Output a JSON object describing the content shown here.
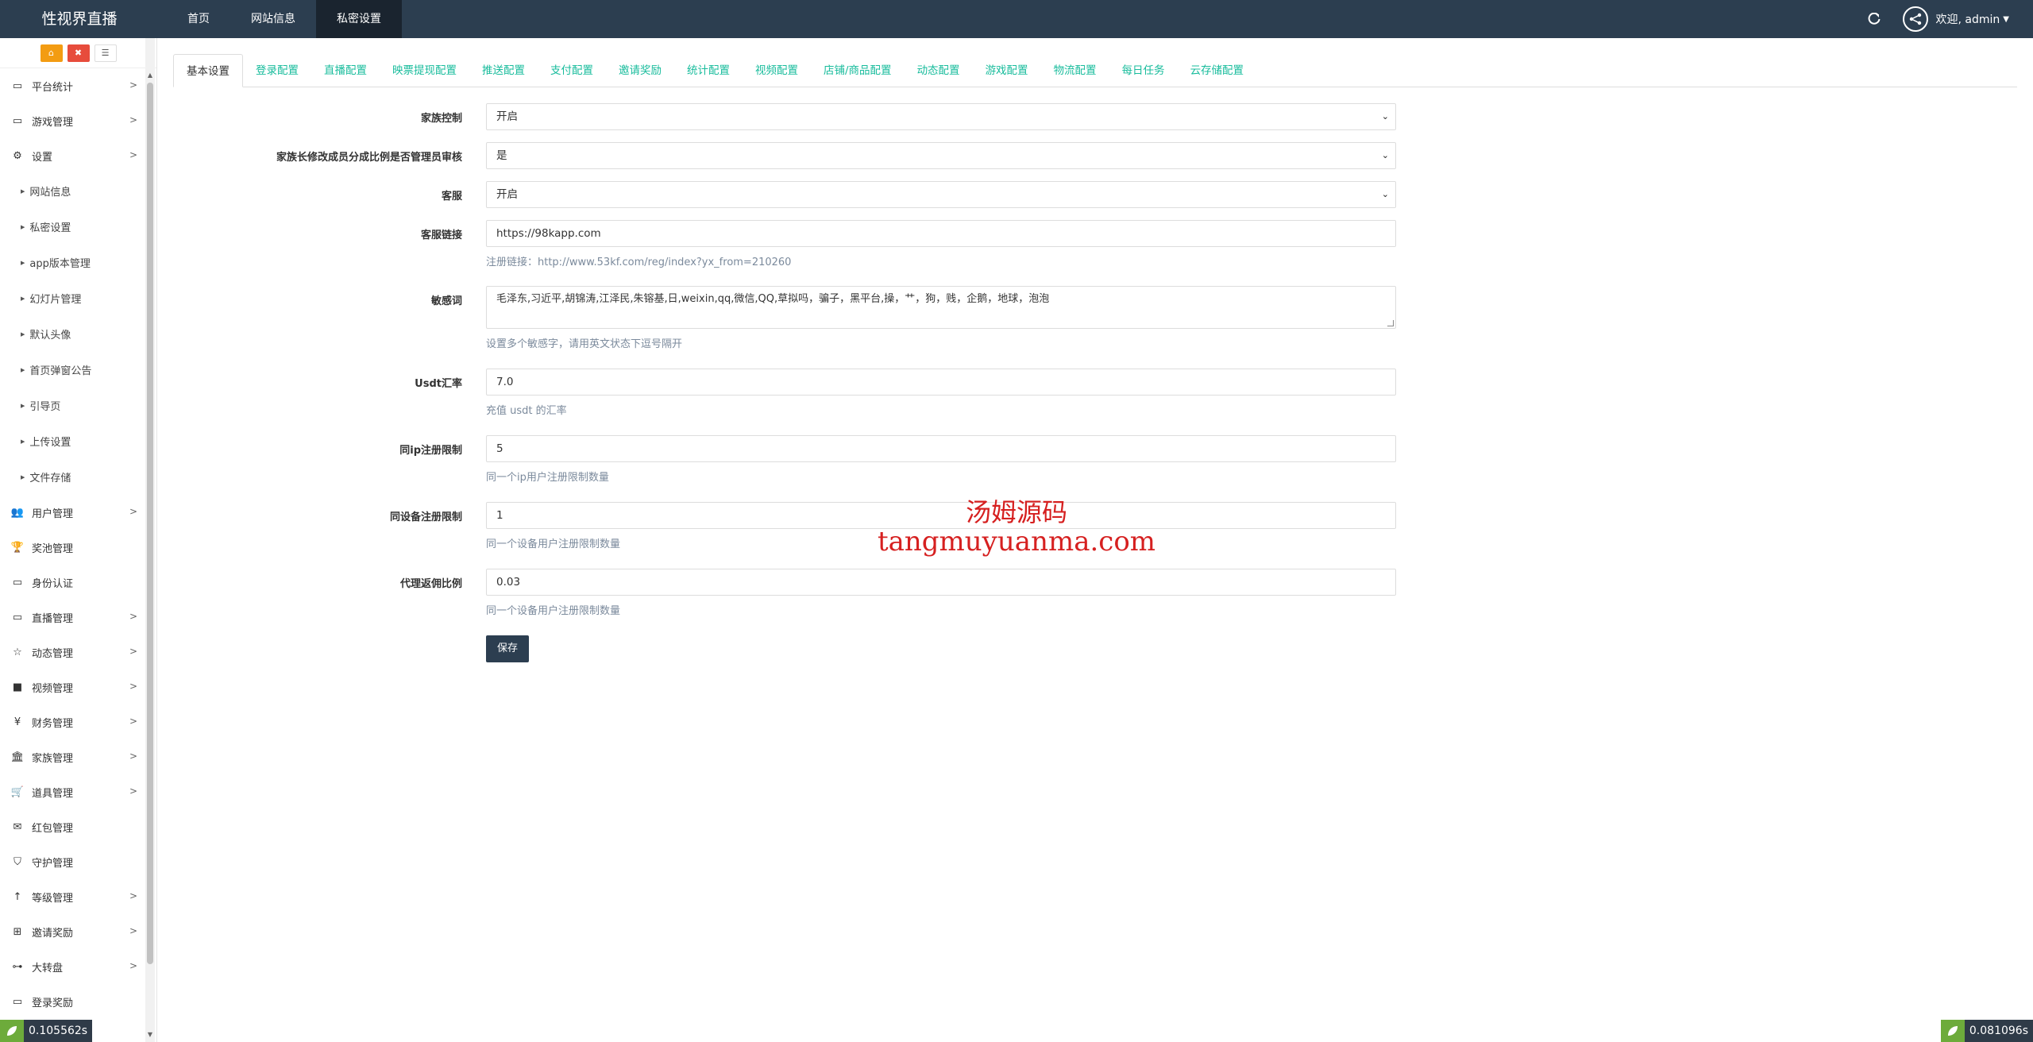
{
  "topbar": {
    "brand": "性视界直播",
    "nav": [
      "首页",
      "网站信息",
      "私密设置"
    ],
    "user": "欢迎, admin"
  },
  "sidebar": {
    "items": [
      {
        "label": "平台统计",
        "icon": "monitor-icon",
        "arrow": true
      },
      {
        "label": "游戏管理",
        "icon": "monitor-icon",
        "arrow": true
      },
      {
        "label": "设置",
        "icon": "cogs-icon",
        "arrow": true
      }
    ],
    "sub_items": [
      "网站信息",
      "私密设置",
      "app版本管理",
      "幻灯片管理",
      "默认头像",
      "首页弹窗公告",
      "引导页",
      "上传设置",
      "文件存储"
    ],
    "items_after": [
      {
        "label": "用户管理",
        "icon": "users-icon",
        "arrow": true
      },
      {
        "label": "奖池管理",
        "icon": "trophy-icon",
        "arrow": false
      },
      {
        "label": "身份认证",
        "icon": "monitor-icon",
        "arrow": false
      },
      {
        "label": "直播管理",
        "icon": "monitor-icon",
        "arrow": true
      },
      {
        "label": "动态管理",
        "icon": "star-icon",
        "arrow": true
      },
      {
        "label": "视频管理",
        "icon": "video-icon",
        "arrow": true
      },
      {
        "label": "财务管理",
        "icon": "yen-icon",
        "arrow": true
      },
      {
        "label": "家族管理",
        "icon": "bank-icon",
        "arrow": true
      },
      {
        "label": "道具管理",
        "icon": "cart-icon",
        "arrow": true
      },
      {
        "label": "红包管理",
        "icon": "envelope-icon",
        "arrow": false
      },
      {
        "label": "守护管理",
        "icon": "shield-icon",
        "arrow": false
      },
      {
        "label": "等级管理",
        "icon": "level-up-icon",
        "arrow": true
      },
      {
        "label": "邀请奖励",
        "icon": "sitemap-icon",
        "arrow": true
      },
      {
        "label": "大转盘",
        "icon": "gamepad-icon",
        "arrow": true
      },
      {
        "label": "登录奖励",
        "icon": "monitor-icon",
        "arrow": false
      }
    ]
  },
  "tabs": [
    "基本设置",
    "登录配置",
    "直播配置",
    "映票提现配置",
    "推送配置",
    "支付配置",
    "邀请奖励",
    "统计配置",
    "视频配置",
    "店铺/商品配置",
    "动态配置",
    "游戏配置",
    "物流配置",
    "每日任务",
    "云存储配置"
  ],
  "form": {
    "family_control": {
      "label": "家族控制",
      "value": "开启"
    },
    "family_review": {
      "label": "家族长修改成员分成比例是否管理员审核",
      "value": "是"
    },
    "service": {
      "label": "客服",
      "value": "开启"
    },
    "service_link": {
      "label": "客服链接",
      "value": "https://98kapp.com",
      "help": "注册链接：http://www.53kf.com/reg/index?yx_from=210260"
    },
    "sensitive": {
      "label": "敏感词",
      "value": "毛泽东,习近平,胡锦涛,江泽民,朱镕基,日,weixin,qq,微信,QQ,草拟吗，骗子，黑平台,操，艹，狗，贱，企鹅，地球，泡泡",
      "help": "设置多个敏感字，请用英文状态下逗号隔开"
    },
    "usdt": {
      "label": "Usdt汇率",
      "value": "7.0",
      "help": "充值 usdt 的汇率"
    },
    "ip_limit": {
      "label": "同ip注册限制",
      "value": "5",
      "help": "同一个ip用户注册限制数量"
    },
    "device_limit": {
      "label": "同设备注册限制",
      "value": "1",
      "help": "同一个设备用户注册限制数量"
    },
    "agent_rate": {
      "label": "代理返佣比例",
      "value": "0.03",
      "help": "同一个设备用户注册限制数量"
    },
    "save_label": "保存"
  },
  "watermark": {
    "line1": "汤姆源码",
    "line2": "tangmuyuanma.com"
  },
  "timers": {
    "left": "0.105562s",
    "right": "0.081096s"
  },
  "colors": {
    "topbar": "#2c3e50",
    "tab_link": "#18bc9c",
    "help_text": "#7b8a9c",
    "watermark": "#d62020"
  }
}
